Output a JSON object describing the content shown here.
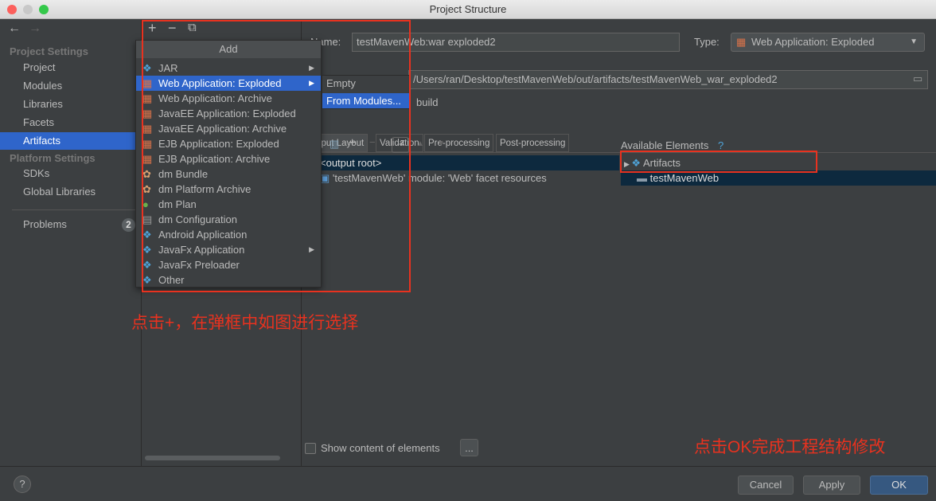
{
  "window": {
    "title": "Project Structure"
  },
  "nav": {
    "back": "←",
    "forward": "→"
  },
  "sidebar": {
    "section1": "Project Settings",
    "items1": [
      "Project",
      "Modules",
      "Libraries",
      "Facets",
      "Artifacts"
    ],
    "section2": "Platform Settings",
    "items2": [
      "SDKs",
      "Global Libraries"
    ],
    "problems": "Problems",
    "problems_count": "2"
  },
  "middle_toolbar": {
    "add": "+",
    "remove": "−",
    "copy": "⧉"
  },
  "popup": {
    "title": "Add",
    "items": [
      {
        "label": "JAR",
        "icon": "jar-icon"
      },
      {
        "label": "Web Application: Exploded",
        "icon": "web-app-icon"
      },
      {
        "label": "Web Application: Archive",
        "icon": "web-app-icon"
      },
      {
        "label": "JavaEE Application: Exploded",
        "icon": "javaee-icon"
      },
      {
        "label": "JavaEE Application: Archive",
        "icon": "javaee-icon"
      },
      {
        "label": "EJB Application: Exploded",
        "icon": "ejb-icon"
      },
      {
        "label": "EJB Application: Archive",
        "icon": "ejb-icon"
      },
      {
        "label": "dm Bundle",
        "icon": "dm-bundle-icon"
      },
      {
        "label": "dm Platform Archive",
        "icon": "dm-platform-icon"
      },
      {
        "label": "dm Plan",
        "icon": "dm-plan-icon"
      },
      {
        "label": "dm Configuration",
        "icon": "dm-config-icon"
      },
      {
        "label": "Android Application",
        "icon": "android-icon"
      },
      {
        "label": "JavaFx Application",
        "icon": "javafx-icon"
      },
      {
        "label": "JavaFx Preloader",
        "icon": "javafx-icon"
      },
      {
        "label": "Other",
        "icon": "other-icon"
      }
    ],
    "submenu": [
      "Empty",
      "From Modules..."
    ]
  },
  "form": {
    "name_label": "Name:",
    "name_value": "testMavenWeb:war exploded2",
    "type_label": "Type:",
    "type_value": "Web Application: Exploded",
    "output_dir": "/Users/ran/Desktop/testMavenWeb/out/artifacts/testMavenWeb_war_exploded2",
    "include_build": "build"
  },
  "tabs": [
    "Output Layout",
    "Validation",
    "Pre-processing",
    "Post-processing"
  ],
  "layout_tree": [
    "<output root>",
    "'testMavenWeb' module: 'Web' facet resources"
  ],
  "available": {
    "title": "Available Elements",
    "help": "?",
    "items": [
      "Artifacts",
      "testMavenWeb"
    ]
  },
  "show_content": "Show content of elements",
  "more_button": "...",
  "buttons": {
    "help": "?",
    "cancel": "Cancel",
    "apply": "Apply",
    "ok": "OK"
  },
  "annotations": [
    "点击+，在弹框中如图进行选择",
    "点击OK完成工程结构修改"
  ],
  "colors": {
    "selection": "#2f65ca",
    "annotation": "#e8321f",
    "ok": "#365880"
  }
}
